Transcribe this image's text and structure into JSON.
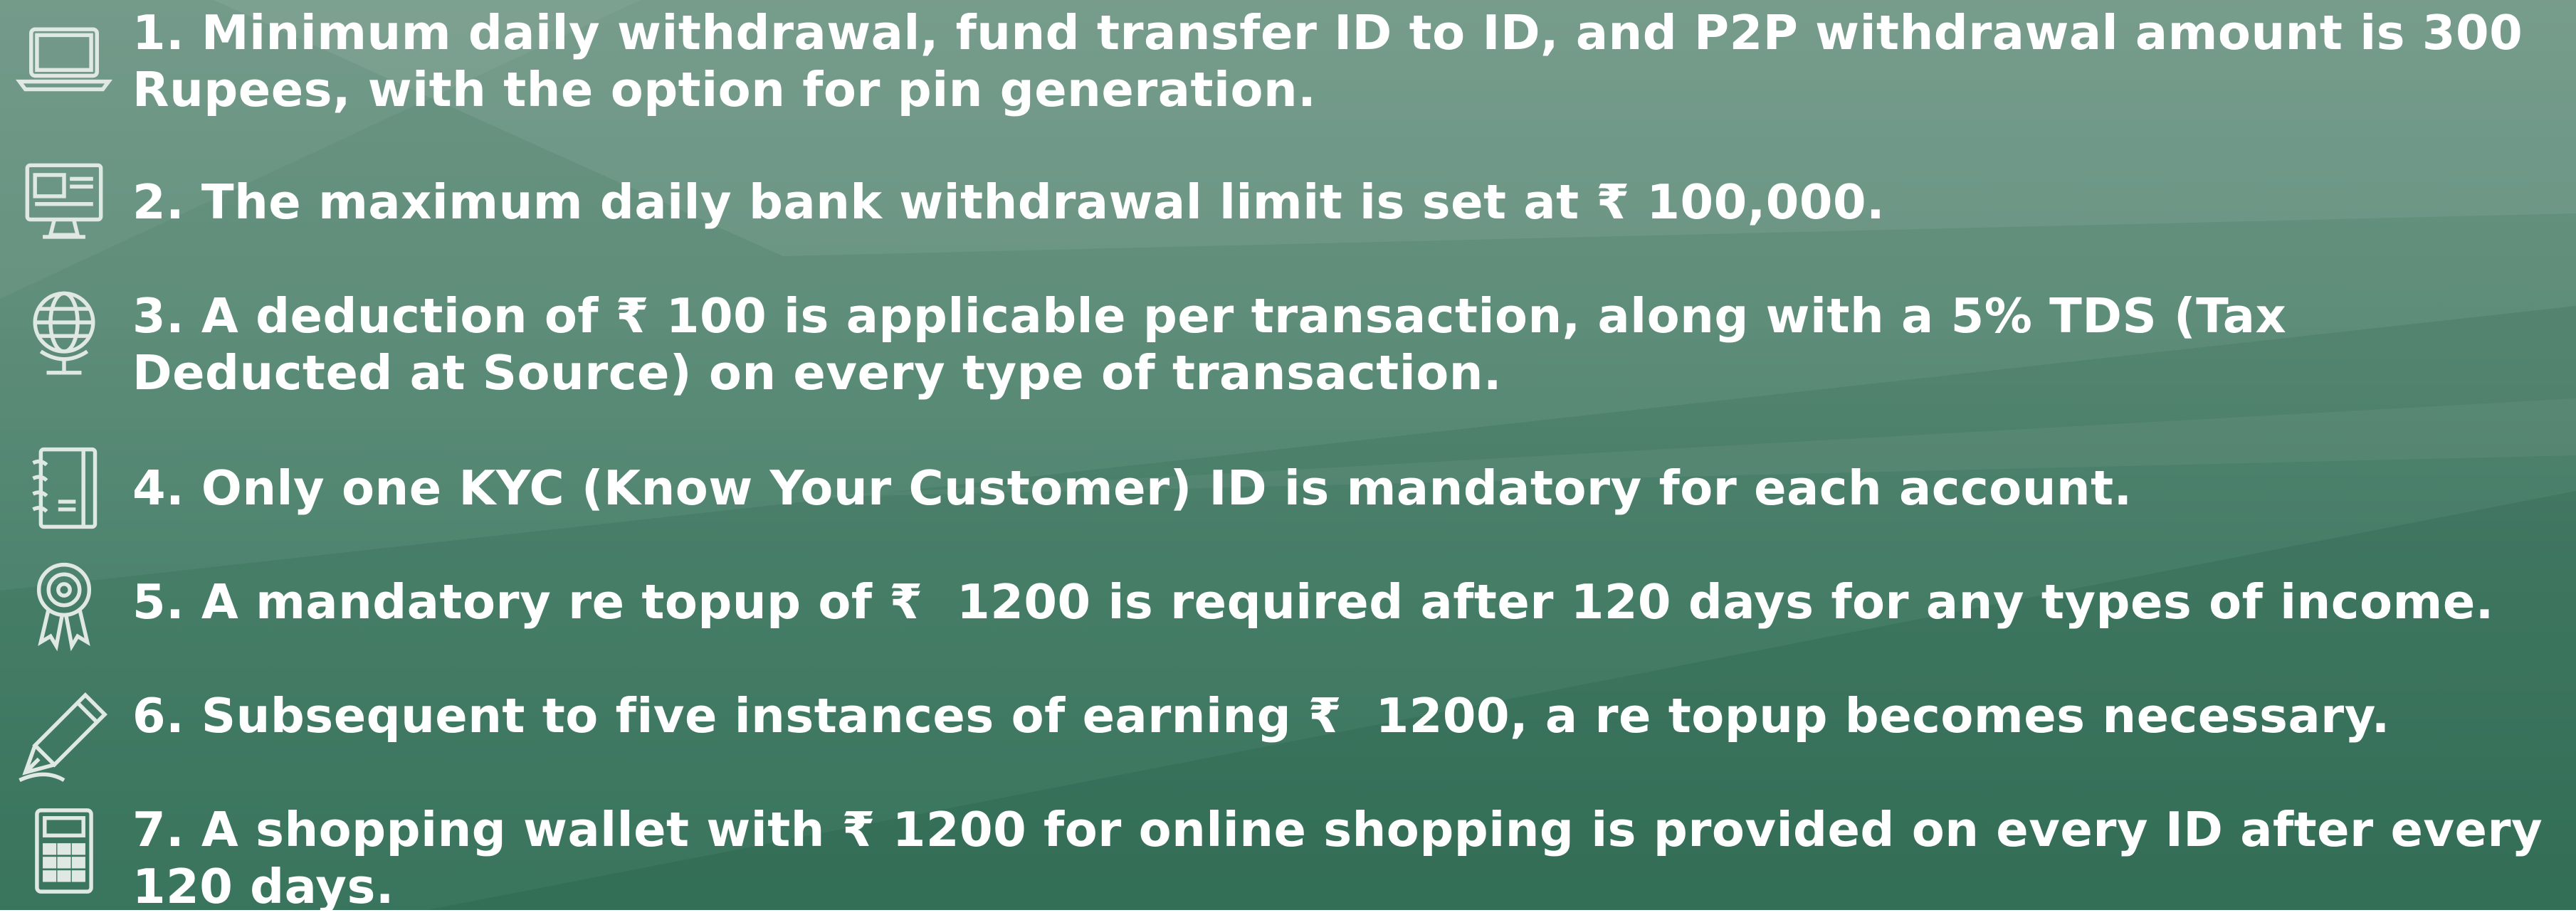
{
  "items": [
    {
      "icon": "laptop-icon",
      "text": "1. Minimum daily withdrawal, fund transfer ID to ID, and P2P withdrawal amount is 300 Rupees, with the option for pin generation."
    },
    {
      "icon": "monitor-icon",
      "text": "2. The maximum daily bank withdrawal limit is set at ₹ 100,000."
    },
    {
      "icon": "globe-icon",
      "text": "3. A deduction of ₹ 100 is applicable per transaction, along with a 5% TDS (Tax Deducted at Source) on every type of transaction."
    },
    {
      "icon": "notebook-icon",
      "text": "4. Only one KYC (Know Your Customer) ID is mandatory for each account."
    },
    {
      "icon": "award-ribbon-icon",
      "text": "5. A mandatory re topup of ₹  1200 is required after 120 days for any types of income."
    },
    {
      "icon": "pen-icon",
      "text": "6. Subsequent to five instances of earning ₹  1200, a re topup becomes necessary."
    },
    {
      "icon": "calculator-icon",
      "text": "7. A shopping wallet with ₹ 1200 for online shopping is provided on every ID after every 120 days."
    }
  ]
}
